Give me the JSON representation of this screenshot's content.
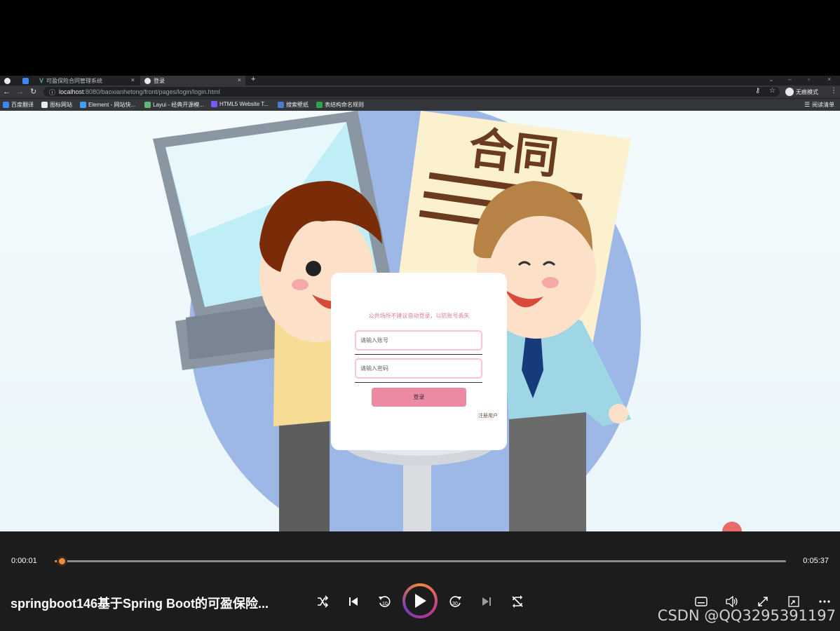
{
  "browser": {
    "tabs": [
      {
        "label": "",
        "icon": "globe-icon"
      },
      {
        "label": "",
        "icon": "pin-icon"
      },
      {
        "label": "可盈保险合同管理系统",
        "icon": "vue-icon"
      },
      {
        "label": "登录",
        "icon": "globe-icon"
      }
    ],
    "url_host": "localhost",
    "url_path": ":8080/baoxianhetong/front/pages/login/login.html",
    "incognito_label": "无痕模式",
    "bookmarks": [
      {
        "label": "百度翻译",
        "color": "#3c8af0"
      },
      {
        "label": "图标网站",
        "color": "#e8eaed"
      },
      {
        "label": "Element - 网站快...",
        "color": "#409eff"
      },
      {
        "label": "Layui - 经典开源模...",
        "color": "#5fb878"
      },
      {
        "label": "HTML5 Website T...",
        "color": "#7a5af8"
      },
      {
        "label": "搜索壁纸",
        "color": "#4a7bd0"
      },
      {
        "label": "表结构命名规则",
        "color": "#2ea44f"
      }
    ],
    "reading_list_label": "阅读清单"
  },
  "illustration": {
    "contract_text": "合同"
  },
  "login": {
    "tip": "公共场所不建议自动登录，以防账号丢失",
    "username_placeholder": "请输入账号",
    "password_placeholder": "请输入密码",
    "submit_label": "登录",
    "register_label": "注册用户",
    "accent_color": "#ec8aa3"
  },
  "player": {
    "current_time": "0:00:01",
    "total_time": "0:05:37",
    "progress_fraction": 0.01,
    "title": "springboot146基于Spring Boot的可盈保险...",
    "accent_color": "#f08a3c",
    "controls": [
      "shuffle-icon",
      "previous-icon",
      "rewind-10-icon",
      "play-icon",
      "forward-30-icon",
      "next-icon",
      "repeat-off-icon",
      "subtitles-icon",
      "volume-icon",
      "fullscreen-icon",
      "mini-player-icon",
      "more-icon"
    ]
  },
  "watermark": "CSDN @QQ3295391197"
}
